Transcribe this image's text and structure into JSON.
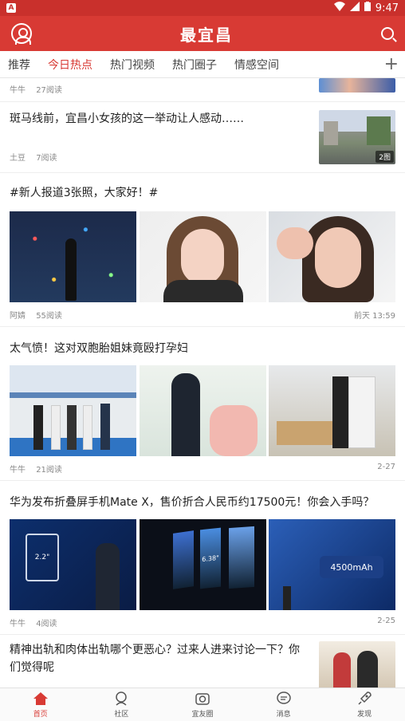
{
  "status": {
    "time": "9:47"
  },
  "header": {
    "title": "最宜昌"
  },
  "tabs": [
    {
      "label": "推荐"
    },
    {
      "label": "今日热点"
    },
    {
      "label": "热门视频"
    },
    {
      "label": "热门圈子"
    },
    {
      "label": "情感空间"
    }
  ],
  "feed": {
    "partial": {
      "author": "牛牛",
      "reads": "27阅读"
    },
    "item1": {
      "title": "斑马线前，宜昌小女孩的这一举动让人感动……",
      "author": "土豆",
      "reads": "7阅读",
      "badge": "2图"
    },
    "item2": {
      "title": "#新人报道3张照，大家好！#",
      "author": "阿婧",
      "reads": "55阅读",
      "time": "前天 13:59"
    },
    "item3": {
      "title": "太气愤！这对双胞胎姐妹竟殴打孕妇",
      "author": "牛牛",
      "reads": "21阅读",
      "time": "2-27"
    },
    "item4": {
      "title": "华为发布折叠屏手机Mate X，售价折合人民币约17500元！你会入手吗？",
      "author": "牛牛",
      "reads": "4阅读",
      "time": "2-25",
      "img1_text": "2.2\"",
      "img2_text": "6.38\"",
      "img3_text": "4500mAh"
    },
    "item5": {
      "title": "精神出轨和肉体出轨哪个更恶心？过来人进来讨论一下？你们觉得呢"
    }
  },
  "nav": [
    {
      "label": "首页"
    },
    {
      "label": "社区"
    },
    {
      "label": "宜友圈"
    },
    {
      "label": "消息"
    },
    {
      "label": "发现"
    }
  ],
  "colors": {
    "brand": "#d83a34"
  }
}
